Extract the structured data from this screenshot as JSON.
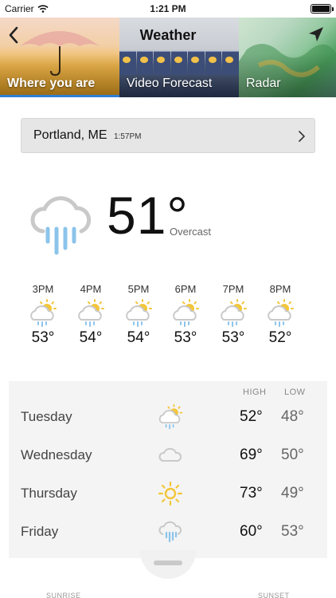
{
  "status": {
    "carrier": "Carrier",
    "time": "1:21 PM"
  },
  "header": {
    "title": "Weather",
    "tabs": [
      {
        "label": "Where you are",
        "active": true
      },
      {
        "label": "Video Forecast",
        "active": false
      },
      {
        "label": "Radar",
        "active": false
      }
    ],
    "active_color": "#2f7fd6"
  },
  "location": {
    "name": "Portland, ME",
    "time": "1:57PM"
  },
  "current": {
    "temp": "51°",
    "condition": "Overcast",
    "icon": "rain-cloud-icon"
  },
  "hourly": [
    {
      "time": "3PM",
      "temp": "53°",
      "icon": "sun-rain-icon"
    },
    {
      "time": "4PM",
      "temp": "54°",
      "icon": "sun-rain-icon"
    },
    {
      "time": "5PM",
      "temp": "54°",
      "icon": "sun-rain-icon"
    },
    {
      "time": "6PM",
      "temp": "53°",
      "icon": "sun-rain-icon"
    },
    {
      "time": "7PM",
      "temp": "53°",
      "icon": "sun-rain-icon"
    },
    {
      "time": "8PM",
      "temp": "52°",
      "icon": "sun-rain-icon"
    }
  ],
  "daily": {
    "high_label": "HIGH",
    "low_label": "LOW",
    "days": [
      {
        "name": "Tuesday",
        "high": "52°",
        "low": "48°",
        "icon": "sun-rain-icon"
      },
      {
        "name": "Wednesday",
        "high": "69°",
        "low": "50°",
        "icon": "cloud-icon"
      },
      {
        "name": "Thursday",
        "high": "73°",
        "low": "49°",
        "icon": "sun-icon"
      },
      {
        "name": "Friday",
        "high": "60°",
        "low": "53°",
        "icon": "rain-cloud-icon"
      }
    ]
  },
  "sun": {
    "sunrise_label": "SUNRISE",
    "sunset_label": "SUNSET"
  },
  "colors": {
    "sun": "#f3c63a",
    "rain": "#8cc4ea",
    "cloud": "#c9c9c9"
  }
}
